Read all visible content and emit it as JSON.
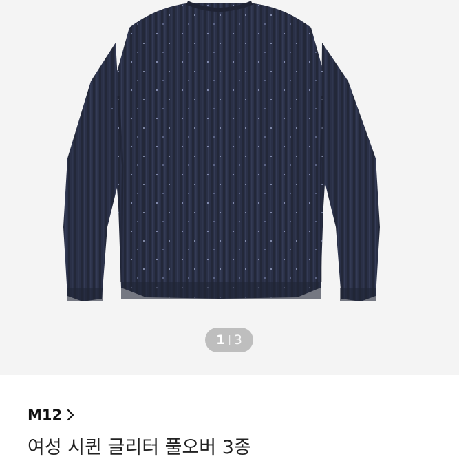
{
  "gallery": {
    "image_icon": "knit-sweater-image",
    "current_page": "1",
    "separator": "|",
    "total_pages": "3"
  },
  "product": {
    "brand": "M12",
    "brand_chevron_icon": "chevron-right-icon",
    "title": "여성 시퀸 글리터 풀오버 3종"
  },
  "colors": {
    "gallery_bg": "#f4f4f4",
    "sweater": "#2a3047",
    "indicator_bg": "rgba(0,0,0,0.22)"
  }
}
